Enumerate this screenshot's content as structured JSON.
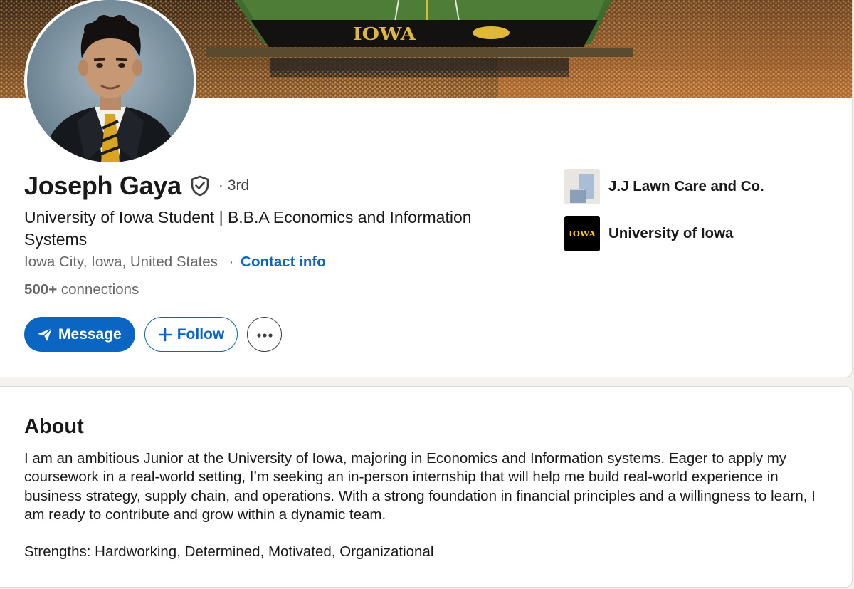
{
  "profile": {
    "name": "Joseph Gaya",
    "degree_separator": "·",
    "degree": "3rd",
    "headline": "University of Iowa Student | B.B.A Economics and Information Systems",
    "location": "Iowa City, Iowa, United States",
    "location_separator": "·",
    "contact_info_label": "Contact info",
    "connections_count": "500+",
    "connections_label": " connections"
  },
  "banner": {
    "field_text": "IOWA"
  },
  "actions": {
    "message_label": "Message",
    "message_icon": "paper-plane-icon",
    "follow_label": "Follow",
    "follow_icon": "plus-icon",
    "more_icon": "ellipsis-icon"
  },
  "organizations": [
    {
      "name": "J.J Lawn Care and Co.",
      "logo": "company-placeholder-logo"
    },
    {
      "name": "University of Iowa",
      "logo_text": "IOWA"
    }
  ],
  "about": {
    "title": "About",
    "text": "I am an ambitious Junior at the University of Iowa, majoring in Economics and Information systems. Eager to apply my coursework in a real-world setting, I’m seeking an in-person internship that will help me build real-world experience in business strategy, supply chain, and operations. With a strong foundation in financial principles and a willingness to learn, I am ready to contribute and grow within a dynamic team.",
    "strengths": "Strengths: Hardworking, Determined, Motivated, Organizational"
  },
  "colors": {
    "linkedin_blue": "#0a66c2",
    "iowa_gold": "#ffcd00",
    "text_primary": "#191919",
    "text_secondary": "#666666"
  }
}
